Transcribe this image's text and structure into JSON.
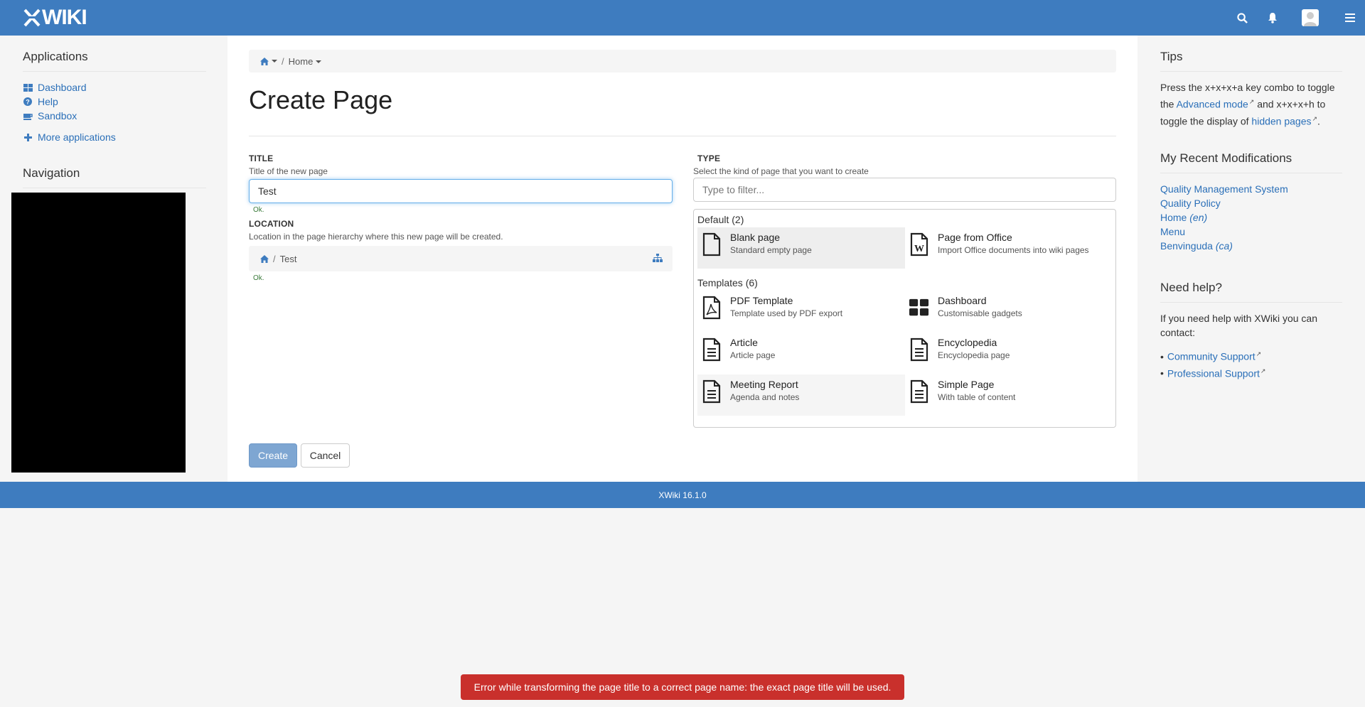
{
  "topbar": {
    "logo_text": "WIKI",
    "brand_color": "#3e7cbf",
    "icons": [
      "search-icon",
      "bell-icon",
      "avatar",
      "hamburger-menu-icon"
    ]
  },
  "left": {
    "applications_title": "Applications",
    "apps": [
      {
        "label": "Dashboard",
        "icon": "dashboard-icon"
      },
      {
        "label": "Help",
        "icon": "help-icon"
      },
      {
        "label": "Sandbox",
        "icon": "sandbox-icon"
      }
    ],
    "more_apps": "More applications",
    "navigation_title": "Navigation"
  },
  "main": {
    "breadcrumb": {
      "home": "Home"
    },
    "page_title": "Create Page",
    "title_label": "TITLE",
    "title_hint": "Title of the new page",
    "title_value": "Test",
    "title_ok": "Ok.",
    "location_label": "LOCATION",
    "location_hint": "Location in the page hierarchy where this new page will be created.",
    "location_path": "Test",
    "location_ok": "Ok.",
    "type_label": "TYPE",
    "type_hint": "Select the kind of page that you want to create",
    "filter_placeholder": "Type to filter...",
    "groups": [
      {
        "title": "Default (2)",
        "items": [
          {
            "name": "Blank page",
            "desc": "Standard empty page",
            "icon": "blank-page-icon",
            "selected": true
          },
          {
            "name": "Page from Office",
            "desc": "Import Office documents into wiki pages",
            "icon": "office-word-icon"
          }
        ]
      },
      {
        "title": "Templates (6)",
        "items": [
          {
            "name": "PDF Template",
            "desc": "Template used by PDF export",
            "icon": "pdf-icon"
          },
          {
            "name": "Dashboard",
            "desc": "Customisable gadgets",
            "icon": "dashboard-grid-icon"
          },
          {
            "name": "Article",
            "desc": "Article page",
            "icon": "document-icon"
          },
          {
            "name": "Encyclopedia",
            "desc": "Encyclopedia page",
            "icon": "document-icon"
          },
          {
            "name": "Meeting Report",
            "desc": "Agenda and notes",
            "icon": "document-icon"
          },
          {
            "name": "Simple Page",
            "desc": "With table of content",
            "icon": "document-icon"
          }
        ]
      }
    ],
    "create_label": "Create",
    "cancel_label": "Cancel"
  },
  "right": {
    "tips_title": "Tips",
    "tips_text_1": "Press the x+x+x+a key combo to toggle the ",
    "tips_link_1": "Advanced mode",
    "tips_text_2": " and x+x+x+h to toggle the display of ",
    "tips_link_2": "hidden pages",
    "tips_text_3": ".",
    "recent_title": "My Recent Modifications",
    "recent": [
      {
        "label": "Quality Management System",
        "lang": ""
      },
      {
        "label": "Quality Policy",
        "lang": ""
      },
      {
        "label": "Home",
        "lang": "(en)"
      },
      {
        "label": "Menu",
        "lang": ""
      },
      {
        "label": "Benvinguda",
        "lang": "(ca)"
      }
    ],
    "help_title": "Need help?",
    "help_text": "If you need help with XWiki you can contact:",
    "help_links": [
      "Community Support",
      "Professional Support"
    ]
  },
  "footer": {
    "version": "XWiki 16.1.0"
  },
  "toast": {
    "message": "Error while transforming the page title to a correct page name: the exact page title will be used.",
    "color": "#c9302c"
  }
}
